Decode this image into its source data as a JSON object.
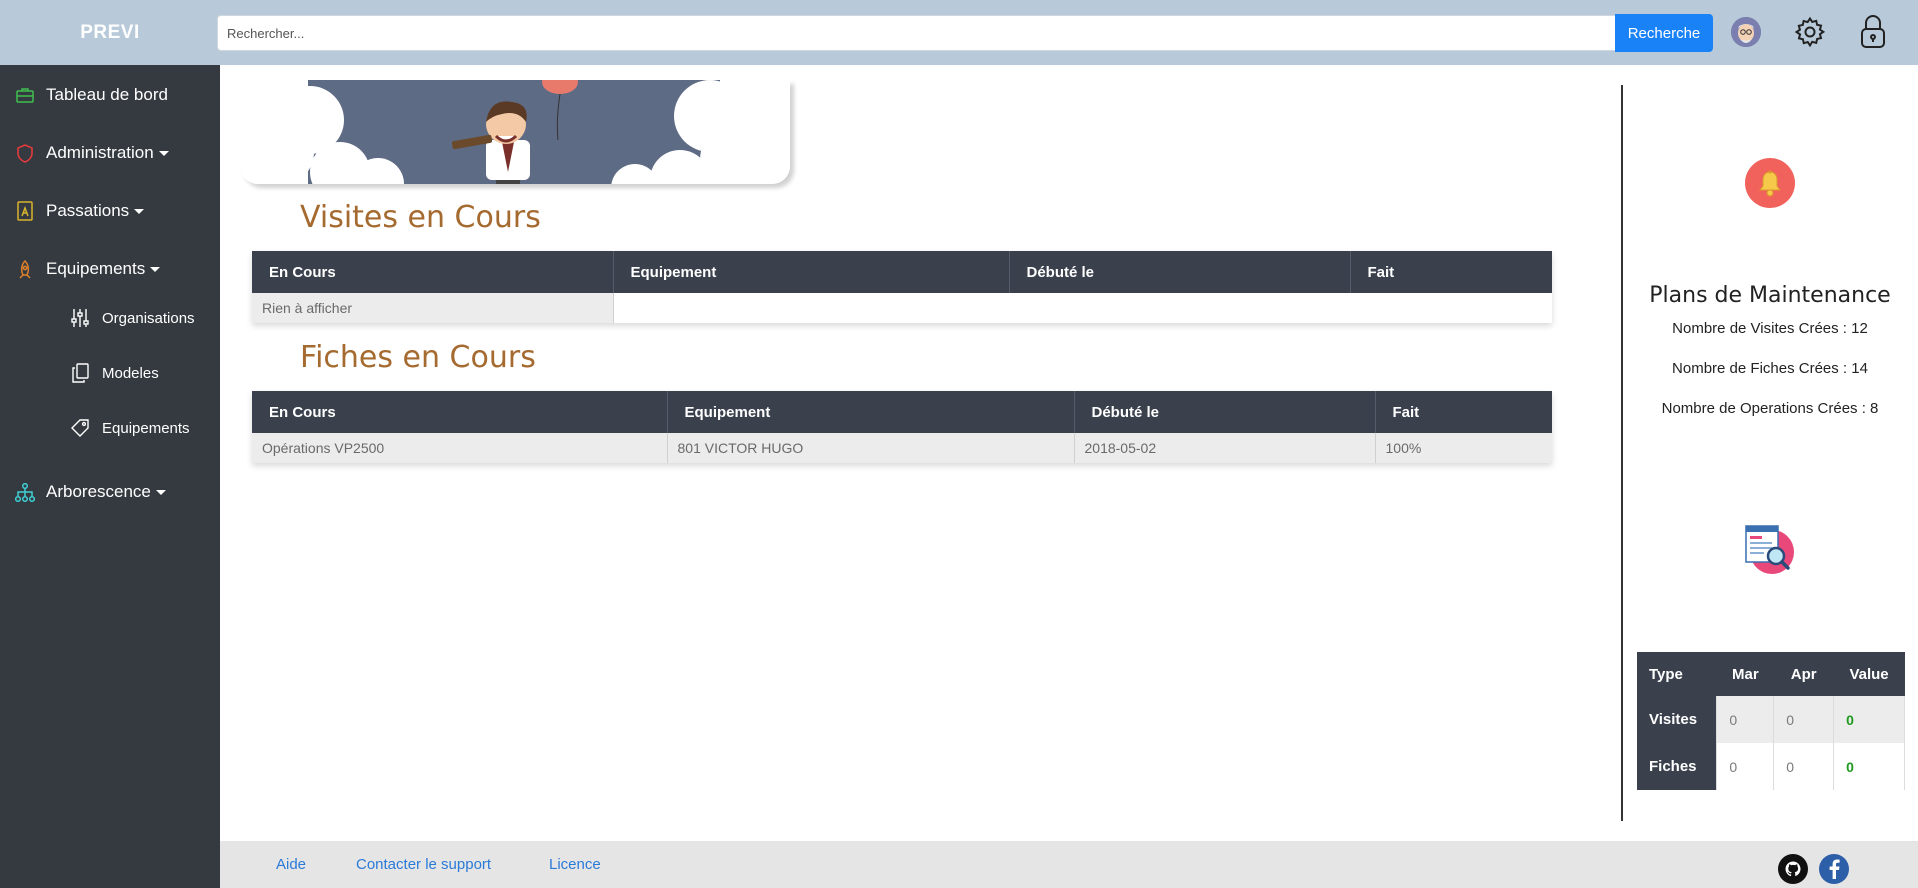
{
  "header": {
    "brand": "PREVI",
    "search_placeholder": "Rechercher...",
    "search_button": "Recherche"
  },
  "sidebar": {
    "items": [
      {
        "label": "Tableau de bord",
        "icon": "briefcase-icon"
      },
      {
        "label": "Administration",
        "icon": "shield-icon"
      },
      {
        "label": "Passations",
        "icon": "document-icon"
      },
      {
        "label": "Equipements",
        "icon": "rocket-icon"
      },
      {
        "label": "Arborescence",
        "icon": "sitemap-icon"
      }
    ],
    "subitems": [
      {
        "label": "Organisations",
        "icon": "sliders-icon"
      },
      {
        "label": "Modeles",
        "icon": "copy-icon"
      },
      {
        "label": "Equipements",
        "icon": "tag-icon"
      }
    ]
  },
  "visites": {
    "title": "Visites en Cours",
    "headers": [
      "En Cours",
      "Equipement",
      "Débuté le",
      "Fait"
    ],
    "empty": "Rien à afficher"
  },
  "fiches": {
    "title": "Fiches en Cours",
    "headers": [
      "En Cours",
      "Equipement",
      "Débuté le",
      "Fait"
    ],
    "rows": [
      [
        "Opérations VP2500",
        "801 VICTOR HUGO",
        "2018-05-02",
        "100%"
      ]
    ]
  },
  "plans": {
    "title": "Plans de Maintenance",
    "lines": [
      "Nombre de Visites Crées : 12",
      "Nombre de Fiches Crées : 14",
      "Nombre de Operations Crées : 8"
    ]
  },
  "stats": {
    "headers": [
      "Type",
      "Mar",
      "Apr",
      "Value"
    ],
    "rows": [
      {
        "type": "Visites",
        "mar": "0",
        "apr": "0",
        "value": "0"
      },
      {
        "type": "Fiches",
        "mar": "0",
        "apr": "0",
        "value": "0"
      }
    ]
  },
  "footer": {
    "links": [
      "Aide",
      "Contacter le support",
      "Licence"
    ]
  },
  "colors": {
    "topbar": "#b8cad9",
    "sidebar": "#343a40",
    "accent": "#1a82f7",
    "section_title": "#a56a2f",
    "table_header": "#3a414d",
    "value_green": "#1e9a1e"
  }
}
